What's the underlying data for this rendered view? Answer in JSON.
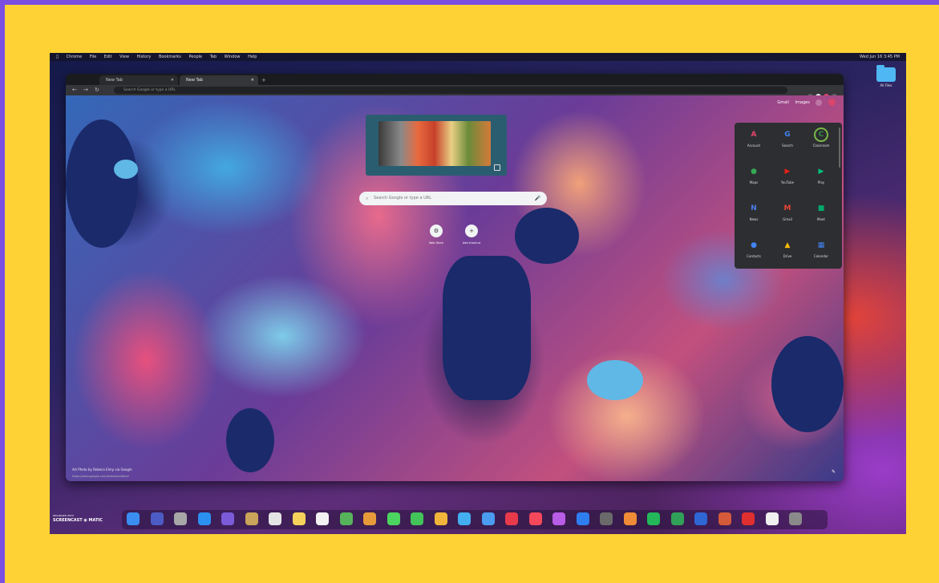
{
  "menubar": {
    "apple": "",
    "items": [
      "Chrome",
      "File",
      "Edit",
      "View",
      "History",
      "Bookmarks",
      "People",
      "Tab",
      "Window",
      "Help"
    ],
    "clock": "Wed Jun 16 3:45 PM"
  },
  "desktop": {
    "folder_label": "All Files"
  },
  "browser": {
    "tabs": [
      {
        "title": "New Tab"
      },
      {
        "title": "New Tab"
      }
    ],
    "new_tab_symbol": "+",
    "omnibox_placeholder": "Search Google or type a URL",
    "ntp": {
      "top_links": [
        "Gmail",
        "Images"
      ],
      "search_placeholder": "Search Google or type a URL",
      "shortcuts": [
        {
          "label": "Web Store",
          "symbol": "⚙"
        },
        {
          "label": "Add shortcut",
          "symbol": "+"
        }
      ],
      "photo_credit": "Art Photo by Rebeca Elmy via Google",
      "photo_credit_sub": "https://www.google.com/webstore/detail",
      "customize_symbol": "✎"
    },
    "apps_menu": [
      {
        "label": "Account",
        "glyph": "A",
        "color": "#e8456b"
      },
      {
        "label": "Search",
        "glyph": "G",
        "color": "#4285f4"
      },
      {
        "label": "Classroom",
        "glyph": "C",
        "color": "#2f8d46"
      },
      {
        "label": "Maps",
        "glyph": "●",
        "color": "#34a853"
      },
      {
        "label": "YouTube",
        "glyph": "▶",
        "color": "#e62117"
      },
      {
        "label": "Play",
        "glyph": "▶",
        "color": "#00c17d"
      },
      {
        "label": "News",
        "glyph": "N",
        "color": "#4a7ee8"
      },
      {
        "label": "Gmail",
        "glyph": "M",
        "color": "#ea4335"
      },
      {
        "label": "Meet",
        "glyph": "■",
        "color": "#00a86b"
      },
      {
        "label": "Contacts",
        "glyph": "●",
        "color": "#4285f4"
      },
      {
        "label": "Drive",
        "glyph": "▲",
        "color": "#fbbc04"
      },
      {
        "label": "Calendar",
        "glyph": "▦",
        "color": "#4285f4"
      }
    ]
  },
  "watermark": {
    "top": "RECORDED WITH",
    "main": "SCREENCAST ◉ MATIC"
  },
  "dock_colors": [
    "#3b8ef0",
    "#4d5cc4",
    "#a7a7a7",
    "#2c90f2",
    "#7b5bd9",
    "#c9a45a",
    "#e4e4e4",
    "#f6d25b",
    "#f2f2f2",
    "#57b35b",
    "#e89a3a",
    "#4cd460",
    "#43c45a",
    "#f0b53a",
    "#43aef0",
    "#4a9cf0",
    "#e83a4a",
    "#f5485a",
    "#b95ce6",
    "#2f7ef0",
    "#6a6a6a",
    "#f08b37",
    "#23b85a",
    "#31a058",
    "#2e66d4",
    "#d45a3a",
    "#e02f2f",
    "#f0f0f0",
    "#8a8a8a"
  ]
}
